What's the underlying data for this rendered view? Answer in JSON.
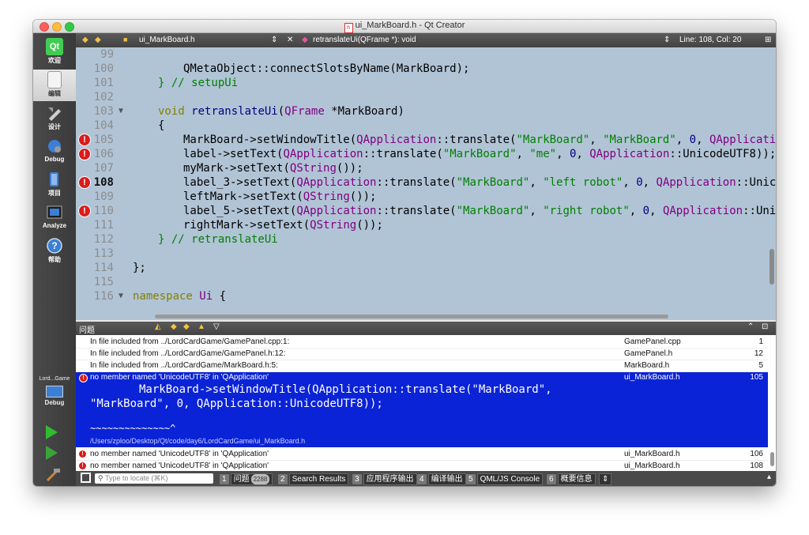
{
  "window": {
    "title": "ui_MarkBoard.h - Qt Creator",
    "file_icon": "h"
  },
  "sidebar": {
    "modes": [
      {
        "label": "欢迎",
        "icon": "qt-logo-icon"
      },
      {
        "label": "编辑",
        "icon": "edit-document-icon"
      },
      {
        "label": "设计",
        "icon": "design-icon"
      },
      {
        "label": "Debug",
        "icon": "debug-icon"
      },
      {
        "label": "项目",
        "icon": "projects-icon"
      },
      {
        "label": "Analyze",
        "icon": "analyze-icon"
      },
      {
        "label": "帮助",
        "icon": "help-icon"
      }
    ],
    "kit_name": "Lord...Game",
    "kit_mode": "Debug"
  },
  "editor_toolbar": {
    "file": "ui_MarkBoard.h",
    "function": "retranslateUi(QFrame *): void",
    "position": "Line: 108, Col: 20"
  },
  "code_lines": [
    {
      "n": "99",
      "err": false,
      "fold": false,
      "cur": false
    },
    {
      "n": "100",
      "err": false,
      "fold": false,
      "cur": false
    },
    {
      "n": "101",
      "err": false,
      "fold": false,
      "cur": false
    },
    {
      "n": "102",
      "err": false,
      "fold": false,
      "cur": false
    },
    {
      "n": "103",
      "err": false,
      "fold": true,
      "cur": false
    },
    {
      "n": "104",
      "err": false,
      "fold": false,
      "cur": false
    },
    {
      "n": "105",
      "err": true,
      "fold": false,
      "cur": false
    },
    {
      "n": "106",
      "err": true,
      "fold": false,
      "cur": false
    },
    {
      "n": "107",
      "err": false,
      "fold": false,
      "cur": false
    },
    {
      "n": "108",
      "err": true,
      "fold": false,
      "cur": true
    },
    {
      "n": "109",
      "err": false,
      "fold": false,
      "cur": false
    },
    {
      "n": "110",
      "err": true,
      "fold": false,
      "cur": false
    },
    {
      "n": "111",
      "err": false,
      "fold": false,
      "cur": false
    },
    {
      "n": "112",
      "err": false,
      "fold": false,
      "cur": false
    },
    {
      "n": "113",
      "err": false,
      "fold": false,
      "cur": false
    },
    {
      "n": "114",
      "err": false,
      "fold": false,
      "cur": false
    },
    {
      "n": "115",
      "err": false,
      "fold": false,
      "cur": false
    },
    {
      "n": "116",
      "err": false,
      "fold": true,
      "cur": false
    }
  ],
  "code": {
    "l100": "QMetaObject::connectSlotsByName(MarkBoard);",
    "l101": "} // setupUi",
    "l103a": "void ",
    "l103b": "retranslateUi",
    "l103c": "(",
    "l103d": "QFrame",
    "l103e": " *MarkBoard)",
    "l104": "{",
    "l105a": "MarkBoard->",
    "l105b": "setWindowTitle",
    "l105c": "(",
    "l105d": "QApplication",
    "l105e": "::translate(",
    "l105f": "\"MarkBoard\"",
    "l105g": ", ",
    "l105h": "\"MarkBoard\"",
    "l105i": ", ",
    "l105j": "0",
    "l105k": ", ",
    "l105l": "QApplicatio",
    "l106a": "label->",
    "l106b": "setText",
    "l106c": "(",
    "l106d": "QApplication",
    "l106e": "::translate(",
    "l106f": "\"MarkBoard\"",
    "l106g": ", ",
    "l106h": "\"me\"",
    "l106i": ", ",
    "l106j": "0",
    "l106k": ", ",
    "l106l": "QApplication",
    "l106m": "::UnicodeUTF8));",
    "l107a": "myMark->",
    "l107b": "setText",
    "l107c": "(",
    "l107d": "QString",
    "l107e": "());",
    "l108a": "label_3->",
    "l108b": "setText",
    "l108c": "(",
    "l108d": "QApplication",
    "l108e": "::translate(",
    "l108f": "\"MarkBoard\"",
    "l108g": ", ",
    "l108h": "\"left robot\"",
    "l108i": ", ",
    "l108j": "0",
    "l108k": ", ",
    "l108l": "QApplication",
    "l108m": "::Unic",
    "l109a": "leftMark->",
    "l109b": "setText",
    "l109c": "(",
    "l109d": "QString",
    "l109e": "());",
    "l110a": "label_5->",
    "l110b": "setText",
    "l110c": "(",
    "l110d": "QApplication",
    "l110e": "::translate(",
    "l110f": "\"MarkBoard\"",
    "l110g": ", ",
    "l110h": "\"right robot\"",
    "l110i": ", ",
    "l110j": "0",
    "l110k": ", ",
    "l110l": "QApplication",
    "l110m": "::Unic",
    "l111a": "rightMark->",
    "l111b": "setText",
    "l111c": "(",
    "l111d": "QString",
    "l111e": "());",
    "l112": "} // retranslateUi",
    "l114": "};",
    "l116a": "namespace ",
    "l116b": "Ui",
    "l116c": " {"
  },
  "issues_panel": {
    "title": "问题",
    "rows": [
      {
        "desc": "In file included from ../LordCardGame/GamePanel.cpp:1:",
        "file": "GamePanel.cpp",
        "line": "1"
      },
      {
        "desc": "In file included from ../LordCardGame/GamePanel.h:12:",
        "file": "GamePanel.h",
        "line": "12"
      },
      {
        "desc": "In file included from ../LordCardGame/MarkBoard.h:5:",
        "file": "MarkBoard.h",
        "line": "5"
      }
    ],
    "selected": {
      "desc": "no member named 'UnicodeUTF8' in 'QApplication'",
      "file": "ui_MarkBoard.h",
      "line": "105",
      "snippet1": "MarkBoard->setWindowTitle(QApplication::translate(\"MarkBoard\",",
      "snippet2": "\"MarkBoard\", 0, QApplication::UnicodeUTF8));",
      "marker": "~~~~~~~~~~~~~~^",
      "path": "/Users/zploo/Desktop/Qt/code/day6/LordCardGame/ui_MarkBoard.h"
    },
    "after_rows": [
      {
        "desc": "no member named 'UnicodeUTF8' in 'QApplication'",
        "file": "ui_MarkBoard.h",
        "line": "106"
      },
      {
        "desc": "no member named 'UnicodeUTF8' in 'QApplication'",
        "file": "ui_MarkBoard.h",
        "line": "108"
      }
    ]
  },
  "statusbar": {
    "locate_placeholder": "Type to locate (⌘K)",
    "tabs": [
      {
        "num": "1",
        "label": "问题",
        "badge": "2288"
      },
      {
        "num": "2",
        "label": "Search Results"
      },
      {
        "num": "3",
        "label": "应用程序输出"
      },
      {
        "num": "4",
        "label": "编译输出"
      },
      {
        "num": "5",
        "label": "QML/JS Console"
      },
      {
        "num": "6",
        "label": "概要信息"
      }
    ]
  },
  "colors": {
    "editor_bg": "#b1c4d6",
    "selection": "#0b23d6",
    "error": "#d91c1c",
    "sidebar": "#404040"
  }
}
